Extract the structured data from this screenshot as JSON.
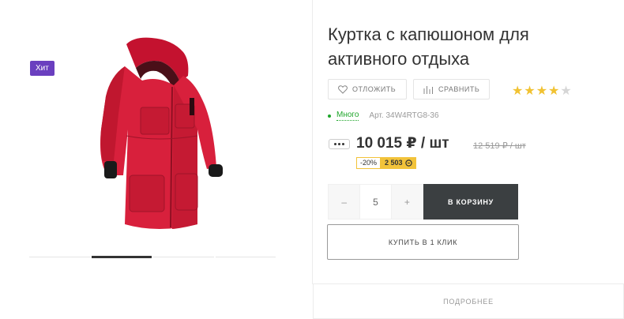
{
  "badge": {
    "label": "Хит"
  },
  "product": {
    "title": "Куртка с капюшоном для активного отдыха",
    "image_icon": "red-jacket-image"
  },
  "gallery": {
    "slides": 4,
    "active_index": 1
  },
  "actions": {
    "delay_label": "ОТЛОЖИТЬ",
    "delay_icon": "heart-icon",
    "compare_label": "СРАВНИТЬ",
    "compare_icon": "bar-chart-icon"
  },
  "rating": {
    "value": 4,
    "max": 5
  },
  "stock": {
    "status": "Много",
    "sku": "Арт. 34W4RTG8-36"
  },
  "price": {
    "current": "10 015 ₽ / шт",
    "old": "12 519 ₽ / шт",
    "discount_percent": "-20%",
    "saving": "2 503"
  },
  "quantity": {
    "minus": "–",
    "value": "5",
    "plus": "+"
  },
  "buttons": {
    "cart": "В КОРЗИНУ",
    "one_click": "КУПИТЬ В 1 КЛИК",
    "more": "ПОДРОБНЕЕ"
  },
  "colors": {
    "badge": "#6a3fbf",
    "stock_green": "#1ea52a",
    "star": "#f1c232",
    "discount": "#f2c33a",
    "cart_button": "#3b3f41",
    "jacket": "#d8203c"
  }
}
